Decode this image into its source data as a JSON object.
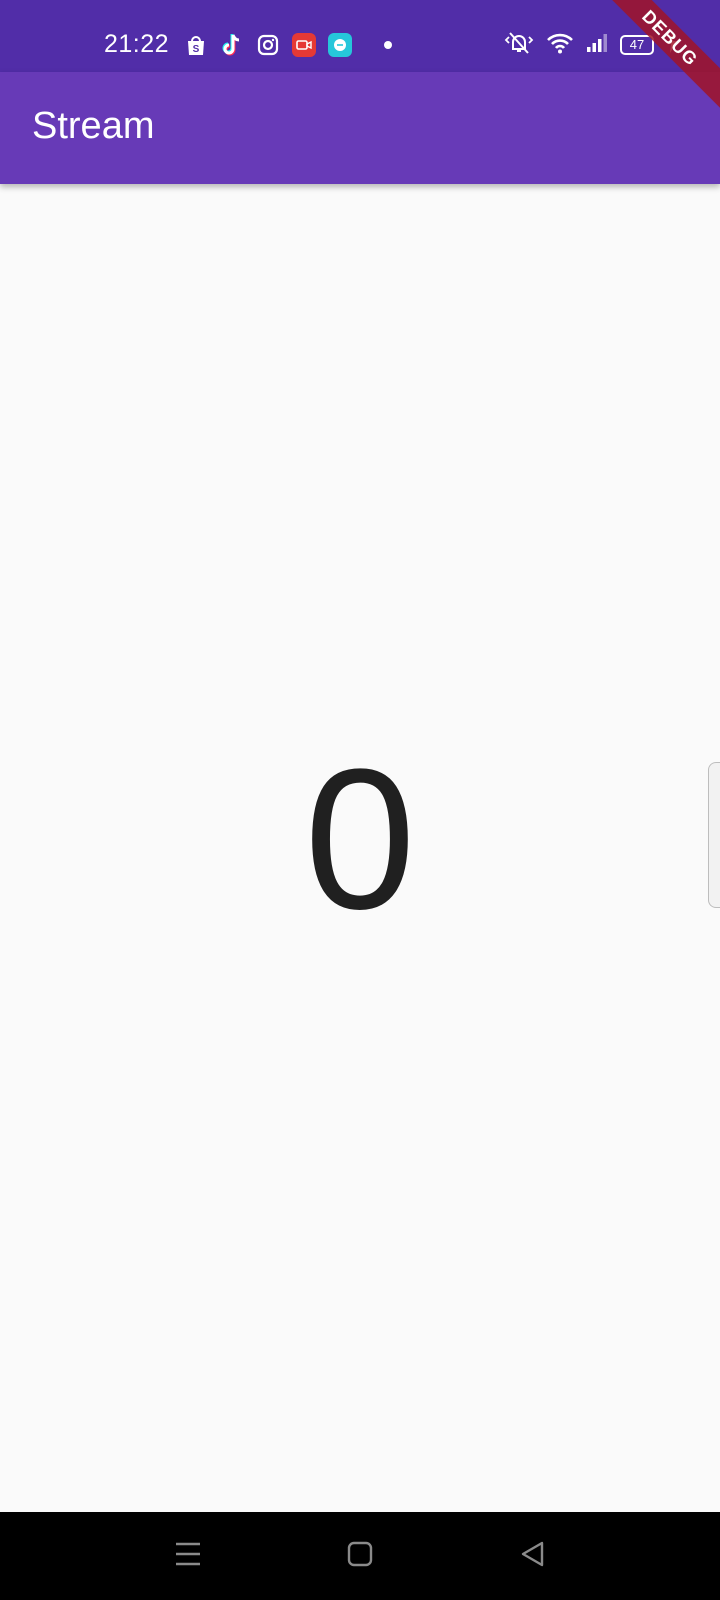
{
  "status_bar": {
    "time": "21:22",
    "battery_level": "47",
    "notification_icons": [
      "shopee-bag-icon",
      "tiktok-icon",
      "instagram-icon",
      "screen-recorder-icon",
      "chat-bubble-icon",
      "dot-icon"
    ],
    "system_icons": [
      "vibrate-icon",
      "wifi-icon",
      "signal-icon",
      "battery-icon",
      "charging-bolt-icon"
    ],
    "background": "#512da8"
  },
  "app_bar": {
    "title": "Stream",
    "background": "#673ab7"
  },
  "debug_banner": {
    "label": "DEBUG"
  },
  "main": {
    "counter_value": "0"
  },
  "nav_bar": {
    "buttons": [
      "menu-icon",
      "home-icon",
      "back-icon"
    ]
  }
}
